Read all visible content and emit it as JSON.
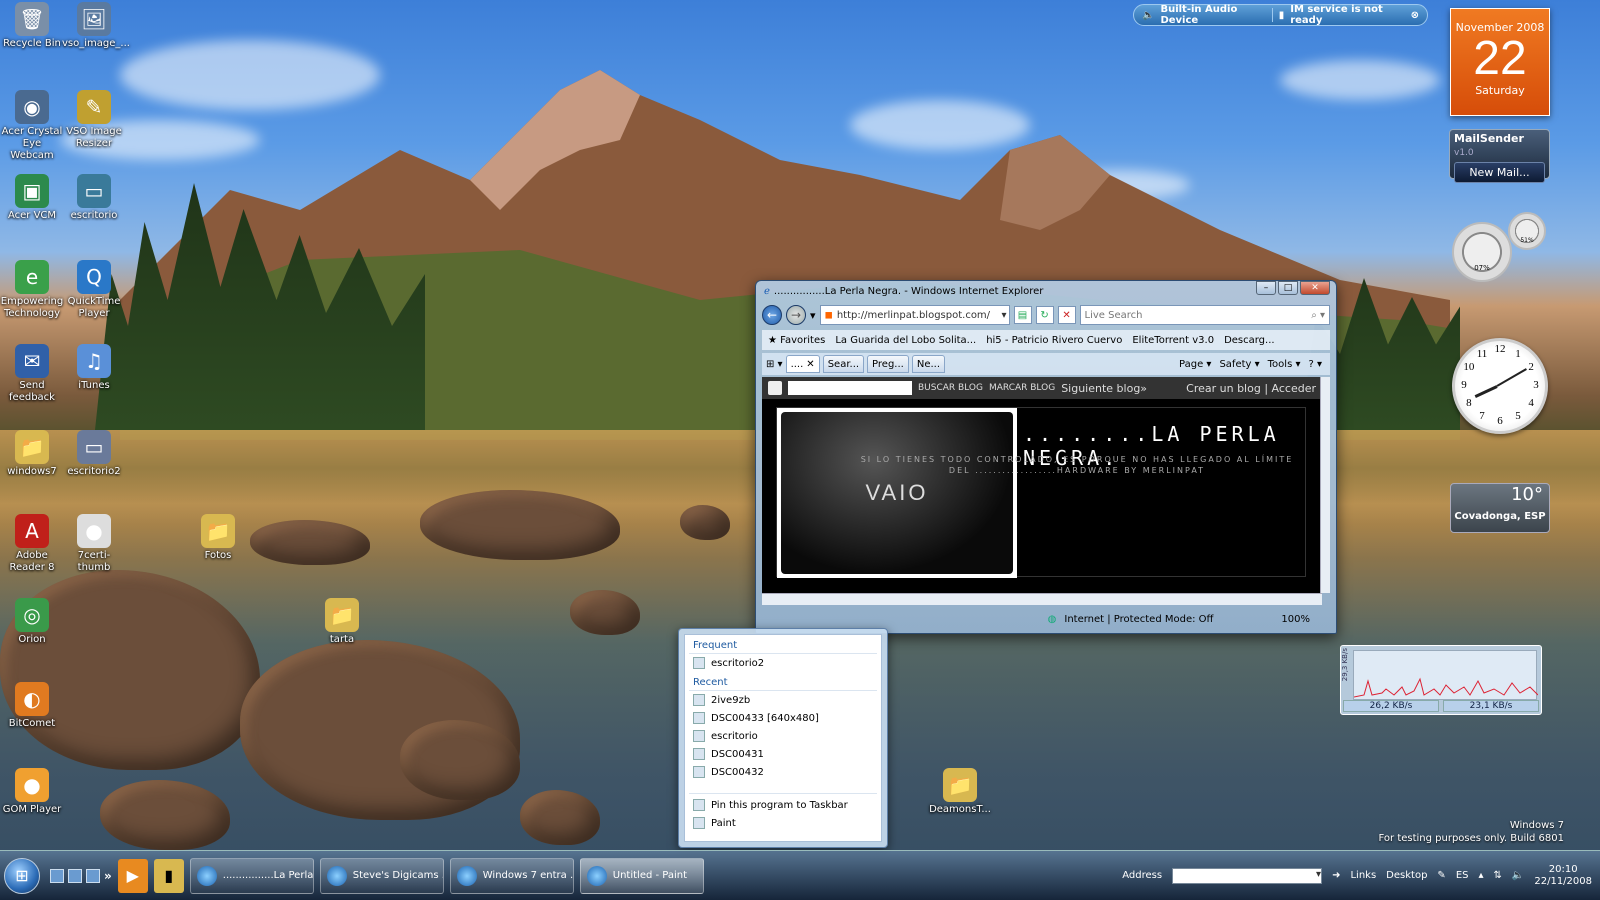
{
  "desktop": {
    "icons": [
      {
        "label": "Recycle Bin",
        "glyph": "🗑",
        "color": "#7a8fa8"
      },
      {
        "label": "vso_image_...",
        "glyph": "🖼",
        "color": "#5a7aa0"
      },
      {
        "label": "Acer Crystal Eye Webcam",
        "glyph": "◉",
        "color": "#4a6a90"
      },
      {
        "label": "VSO Image Resizer",
        "glyph": "✎",
        "color": "#c0a030"
      },
      {
        "label": "Acer VCM",
        "glyph": "▣",
        "color": "#2c8a4c"
      },
      {
        "label": "escritorio",
        "glyph": "▭",
        "color": "#3a7a9a"
      },
      {
        "label": "Empowering Technology",
        "glyph": "e",
        "color": "#3aa04a"
      },
      {
        "label": "QuickTime Player",
        "glyph": "Q",
        "color": "#2a78c8"
      },
      {
        "label": "Send feedback",
        "glyph": "✉",
        "color": "#3060a8"
      },
      {
        "label": "iTunes",
        "glyph": "♫",
        "color": "#5a90d8"
      },
      {
        "label": "windows7",
        "glyph": "📁",
        "color": "#d8b850"
      },
      {
        "label": "escritorio2",
        "glyph": "▭",
        "color": "#6a7a9a"
      },
      {
        "label": "Adobe Reader 8",
        "glyph": "A",
        "color": "#c0201a"
      },
      {
        "label": "7certi-thumb",
        "glyph": "●",
        "color": "#ddd"
      },
      {
        "label": "Fotos",
        "glyph": "📁",
        "color": "#d8b850"
      },
      {
        "label": "Orion",
        "glyph": "◎",
        "color": "#3a9a4a"
      },
      {
        "label": "tarta",
        "glyph": "📁",
        "color": "#d8b850"
      },
      {
        "label": "BitComet",
        "glyph": "◐",
        "color": "#e07a20"
      },
      {
        "label": "GOM Player",
        "glyph": "●",
        "color": "#f0a030"
      },
      {
        "label": "DeamonsT...",
        "glyph": "📁",
        "color": "#d8b850"
      }
    ]
  },
  "notification": {
    "audio": "Built-in Audio Device",
    "im": "IM service is not ready"
  },
  "gadgets": {
    "calendar": {
      "month": "November 2008",
      "day": "22",
      "weekday": "Saturday"
    },
    "mail": {
      "title": "MailSender",
      "version": "v1.0",
      "button": "New Mail..."
    },
    "meter": {
      "cpu": "07%",
      "ram": "51%"
    },
    "clock": {
      "numbers": [
        "12",
        "1",
        "2",
        "3",
        "4",
        "5",
        "6",
        "7",
        "8",
        "9",
        "10",
        "11"
      ],
      "hour": 8,
      "minute": 10
    },
    "weather": {
      "temp": "10°",
      "location": "Covadonga, ESP"
    },
    "network": {
      "scale": "29,3 KB/s",
      "down": "26,2 KB/s",
      "up": "23,1 KB/s"
    }
  },
  "ie": {
    "title": "................La Perla Negra. - Windows Internet Explorer",
    "url": "http://merlinpat.blogspot.com/",
    "search_placeholder": "Live Search",
    "favorites": {
      "label": "Favorites",
      "items": [
        "La Guarida del Lobo Solita...",
        "hi5 - Patricio Rivero Cuervo",
        "EliteTorrent v3.0",
        "Descarg..."
      ]
    },
    "tabs": [
      "....",
      "Sear...",
      "Preg...",
      "Ne..."
    ],
    "commands": [
      "Page ▾",
      "Safety ▾",
      "Tools ▾",
      "? ▾"
    ],
    "blog": {
      "search_btn": "BUSCAR BLOG",
      "flag_btn": "MARCAR BLOG",
      "next": "Siguiente blog»",
      "links": "Crear un blog | Acceder",
      "title": "........LA PERLA NEGRA.",
      "subtitle": "SI LO TIENES TODO CONTROLADO, ES PORQUE NO HAS LLEGADO AL LÍMITE DEL ..................HARDWARE BY MERLINPAT",
      "laptop": "VAIO"
    },
    "status": {
      "zone": "Internet | Protected Mode: Off",
      "zoom": "100%"
    }
  },
  "jumplist": {
    "frequent_header": "Frequent",
    "frequent": [
      "escritorio2"
    ],
    "recent_header": "Recent",
    "recent": [
      "2ive9zb",
      "DSC00433 [640x480]",
      "escritorio",
      "DSC00431",
      "DSC00432"
    ],
    "tasks": [
      "Pin this program to Taskbar",
      "Paint"
    ]
  },
  "taskbar": {
    "buttons": [
      "................La Perla ...",
      "Steve's Digicams ...",
      "Windows 7 entra ...",
      "Untitled - Paint"
    ],
    "address_label": "Address",
    "links": "Links",
    "desktop": "Desktop",
    "lang": "ES",
    "time": "20:10",
    "date": "22/11/2008"
  },
  "watermark": {
    "line1": "Windows 7",
    "line2": "For testing purposes only. Build 6801"
  }
}
